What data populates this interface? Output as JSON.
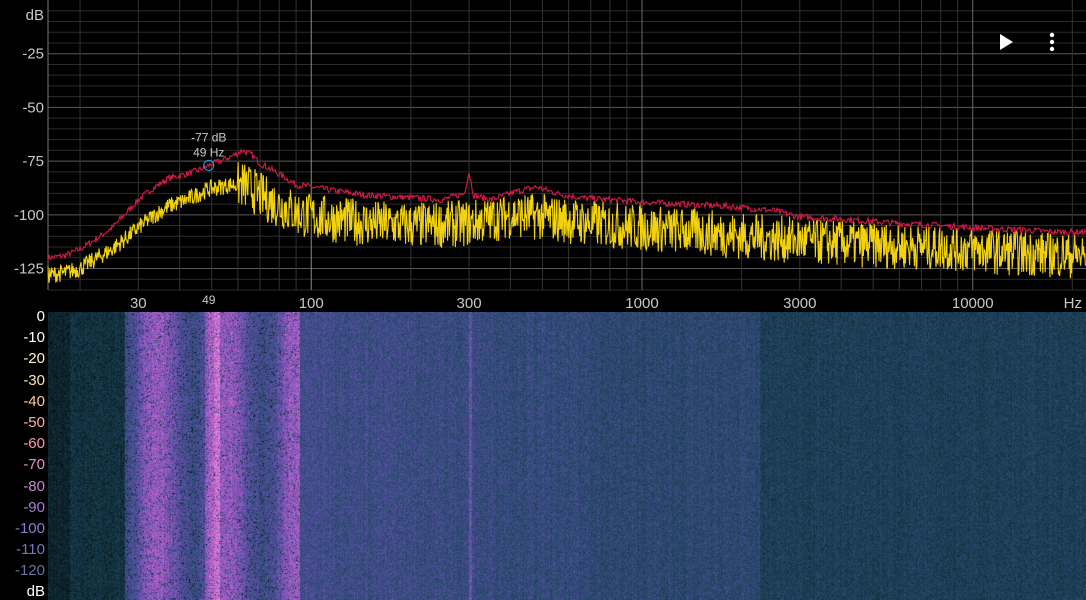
{
  "spectrum": {
    "y_unit": "dB",
    "x_unit": "Hz",
    "y_ticks": [
      {
        "value": -25,
        "label": "-25"
      },
      {
        "value": -50,
        "label": "-50"
      },
      {
        "value": -75,
        "label": "-75"
      },
      {
        "value": -100,
        "label": "-100"
      },
      {
        "value": -125,
        "label": "-125"
      }
    ],
    "x_ticks": [
      {
        "value": 30,
        "label": "30"
      },
      {
        "value": 100,
        "label": "100"
      },
      {
        "value": 300,
        "label": "300"
      },
      {
        "value": 1000,
        "label": "1000"
      },
      {
        "value": 3000,
        "label": "3000"
      },
      {
        "value": 10000,
        "label": "10000"
      }
    ],
    "x_range_hz": [
      16,
      22000
    ],
    "y_range_db": [
      -135,
      0
    ],
    "cursor": {
      "freq_hz": 49,
      "freq_label": "49",
      "db_label": "-77 dB",
      "hz_label": "49 Hz",
      "color": "#2ea3dc"
    },
    "peak_color": "#d81a48",
    "live_color": "#f2d20c",
    "peak_envelope_points": [
      [
        16,
        -120
      ],
      [
        18,
        -119
      ],
      [
        20,
        -116
      ],
      [
        22,
        -112
      ],
      [
        25,
        -106
      ],
      [
        28,
        -98
      ],
      [
        30,
        -93
      ],
      [
        33,
        -88
      ],
      [
        37,
        -83
      ],
      [
        42,
        -81
      ],
      [
        46,
        -79
      ],
      [
        49,
        -77
      ],
      [
        53,
        -75
      ],
      [
        57,
        -73
      ],
      [
        62,
        -70
      ],
      [
        66,
        -72
      ],
      [
        70,
        -76
      ],
      [
        76,
        -79
      ],
      [
        82,
        -82
      ],
      [
        90,
        -86
      ],
      [
        100,
        -87
      ],
      [
        120,
        -89
      ],
      [
        150,
        -91
      ],
      [
        200,
        -92
      ],
      [
        250,
        -93
      ],
      [
        290,
        -90
      ],
      [
        300,
        -80
      ],
      [
        310,
        -91
      ],
      [
        350,
        -93
      ],
      [
        420,
        -89
      ],
      [
        480,
        -87
      ],
      [
        550,
        -90
      ],
      [
        650,
        -92
      ],
      [
        800,
        -93
      ],
      [
        1000,
        -94
      ],
      [
        1300,
        -95
      ],
      [
        1800,
        -96
      ],
      [
        2500,
        -98
      ],
      [
        3000,
        -101
      ],
      [
        4000,
        -102
      ],
      [
        6000,
        -104
      ],
      [
        8000,
        -105
      ],
      [
        10000,
        -106
      ],
      [
        14000,
        -107
      ],
      [
        18000,
        -108
      ],
      [
        22000,
        -108
      ]
    ],
    "live_mean_points": [
      [
        16,
        -128
      ],
      [
        18,
        -127
      ],
      [
        20,
        -125
      ],
      [
        22,
        -121
      ],
      [
        25,
        -116
      ],
      [
        28,
        -110
      ],
      [
        30,
        -106
      ],
      [
        33,
        -101
      ],
      [
        37,
        -96
      ],
      [
        42,
        -93
      ],
      [
        46,
        -90
      ],
      [
        49,
        -88
      ],
      [
        53,
        -87
      ],
      [
        57,
        -86
      ],
      [
        62,
        -86
      ],
      [
        66,
        -88
      ],
      [
        70,
        -91
      ],
      [
        76,
        -94
      ],
      [
        82,
        -96
      ],
      [
        90,
        -99
      ],
      [
        100,
        -101
      ],
      [
        150,
        -104
      ],
      [
        200,
        -105
      ],
      [
        300,
        -104
      ],
      [
        400,
        -100
      ],
      [
        500,
        -101
      ],
      [
        700,
        -104
      ],
      [
        1000,
        -106
      ],
      [
        1500,
        -108
      ],
      [
        2000,
        -110
      ],
      [
        3000,
        -112
      ],
      [
        5000,
        -114
      ],
      [
        8000,
        -115
      ],
      [
        12000,
        -117
      ],
      [
        22000,
        -119
      ]
    ]
  },
  "spectrogram": {
    "unit_label": "dB",
    "scale_labels": [
      {
        "value": 0,
        "label": "0",
        "color": "#ffffff"
      },
      {
        "value": -10,
        "label": "-10",
        "color": "#ffffff"
      },
      {
        "value": -20,
        "label": "-20",
        "color": "#fff6c8"
      },
      {
        "value": -30,
        "label": "-30",
        "color": "#ffe3a8"
      },
      {
        "value": -40,
        "label": "-40",
        "color": "#ffcaa0"
      },
      {
        "value": -50,
        "label": "-50",
        "color": "#ffaf9c"
      },
      {
        "value": -60,
        "label": "-60",
        "color": "#f79ab0"
      },
      {
        "value": -70,
        "label": "-70",
        "color": "#e48cc4"
      },
      {
        "value": -80,
        "label": "-80",
        "color": "#c683d2"
      },
      {
        "value": -90,
        "label": "-90",
        "color": "#a77ed8"
      },
      {
        "value": -100,
        "label": "-100",
        "color": "#8c7ad6"
      },
      {
        "value": -110,
        "label": "-110",
        "color": "#7676c2"
      },
      {
        "value": -120,
        "label": "-120",
        "color": "#6472a8"
      }
    ],
    "unit_color": "#ffffff"
  },
  "toolbar": {
    "play_icon": "play-icon",
    "menu_icon": "more-vertical-icon",
    "icon_color": "#ffffff"
  }
}
